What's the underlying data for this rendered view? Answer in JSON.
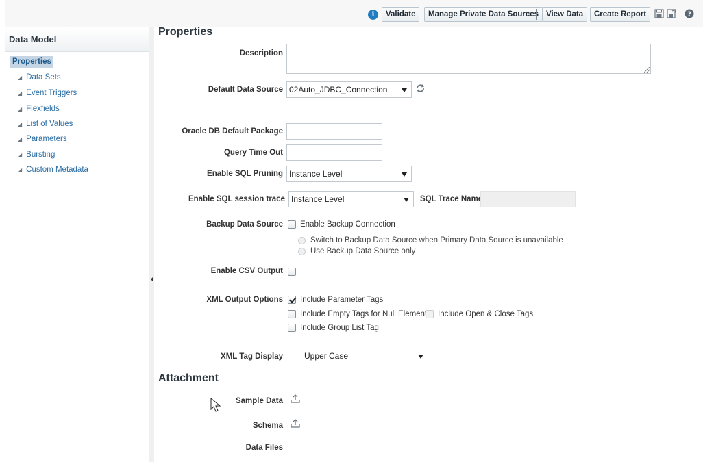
{
  "toolbar": {
    "validate": "Validate",
    "manage_private": "Manage Private Data Sources",
    "view_data": "View Data",
    "create_report": "Create Report"
  },
  "sidebar": {
    "title": "Data Model",
    "selected": "Properties",
    "items": [
      {
        "label": "Data Sets"
      },
      {
        "label": "Event Triggers"
      },
      {
        "label": "Flexfields"
      },
      {
        "label": "List of Values"
      },
      {
        "label": "Parameters"
      },
      {
        "label": "Bursting"
      },
      {
        "label": "Custom Metadata"
      }
    ]
  },
  "main": {
    "heading": "Properties",
    "description_label": "Description",
    "description_value": "",
    "default_ds_label": "Default Data Source",
    "default_ds_value": "02Auto_JDBC_Connection",
    "oracle_pkg_label": "Oracle DB Default Package",
    "oracle_pkg_value": "",
    "query_timeout_label": "Query Time Out",
    "query_timeout_value": "",
    "sql_pruning_label": "Enable SQL Pruning",
    "sql_pruning_value": "Instance Level",
    "sql_trace_label": "Enable SQL session trace",
    "sql_trace_value": "Instance Level",
    "sql_trace_name_label": "SQL Trace Name",
    "sql_trace_name_value": "",
    "backup_label": "Backup Data Source",
    "backup_enable": "Enable Backup Connection",
    "backup_switch": "Switch to Backup Data Source when Primary Data Source is unavailable",
    "backup_only": "Use Backup Data Source only",
    "csv_label": "Enable CSV Output",
    "xml_options_label": "XML Output Options",
    "xml_include_params": "Include Parameter Tags",
    "xml_include_empty": "Include Empty Tags for Null Elements",
    "xml_include_open_close": "Include Open & Close Tags",
    "xml_include_group": "Include Group List Tag",
    "xml_tag_display_label": "XML Tag Display",
    "xml_tag_display_value": "Upper Case",
    "attachment_heading": "Attachment",
    "sample_data_label": "Sample Data",
    "schema_label": "Schema",
    "data_files_label": "Data Files"
  },
  "colors": {
    "link": "#2d6ea3",
    "selected_bg": "#c5d5e3",
    "info": "#1f7cc1"
  }
}
